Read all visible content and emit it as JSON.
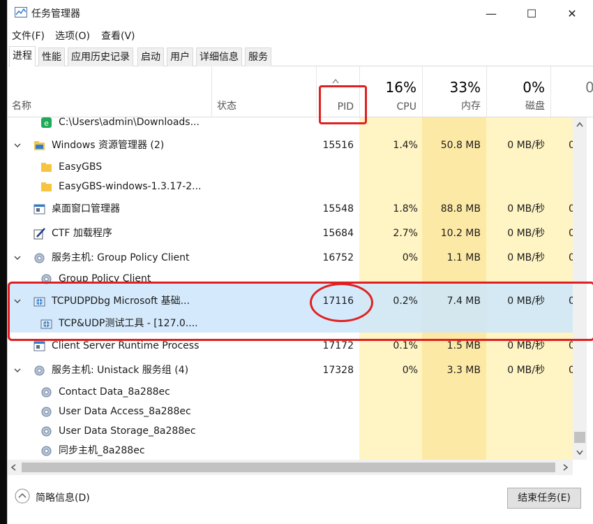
{
  "window": {
    "title": "任务管理器",
    "minimize": "—",
    "maximize": "☐",
    "close": "✕"
  },
  "menu": [
    "文件(F)",
    "选项(O)",
    "查看(V)"
  ],
  "tabs": [
    "进程",
    "性能",
    "应用历史记录",
    "启动",
    "用户",
    "详细信息",
    "服务"
  ],
  "header": {
    "name": "名称",
    "status": "状态",
    "pid": "PID",
    "cpu_pct": "16%",
    "cpu": "CPU",
    "mem_pct": "33%",
    "mem": "内存",
    "disk_pct": "0%",
    "disk": "磁盘",
    "net_pct": "0"
  },
  "rows": [
    {
      "name": "C:\\Users\\admin\\Downloads...",
      "pid": "",
      "cpu": "",
      "mem": "",
      "disk": "",
      "net": "",
      "indent": 1,
      "icon": "green-app-icon",
      "expand": false
    },
    {
      "name": "Windows 资源管理器 (2)",
      "pid": "15516",
      "cpu": "1.4%",
      "mem": "50.8 MB",
      "disk": "0 MB/秒",
      "net": "0",
      "indent": 0,
      "icon": "folder-explorer-icon",
      "expand": true
    },
    {
      "name": "EasyGBS",
      "pid": "",
      "cpu": "",
      "mem": "",
      "disk": "",
      "net": "",
      "indent": 1,
      "icon": "folder-icon",
      "expand": false
    },
    {
      "name": "EasyGBS-windows-1.3.17-2...",
      "pid": "",
      "cpu": "",
      "mem": "",
      "disk": "",
      "net": "",
      "indent": 1,
      "icon": "folder-icon",
      "expand": false
    },
    {
      "name": "桌面窗口管理器",
      "pid": "15548",
      "cpu": "1.8%",
      "mem": "88.8 MB",
      "disk": "0 MB/秒",
      "net": "0",
      "indent": 0,
      "icon": "window-icon",
      "expand": false
    },
    {
      "name": "CTF 加载程序",
      "pid": "15684",
      "cpu": "2.7%",
      "mem": "10.2 MB",
      "disk": "0 MB/秒",
      "net": "0",
      "indent": 0,
      "icon": "pen-icon",
      "expand": false
    },
    {
      "name": "服务主机: Group Policy Client",
      "pid": "16752",
      "cpu": "0%",
      "mem": "1.1 MB",
      "disk": "0 MB/秒",
      "net": "0",
      "indent": 0,
      "icon": "gear-icon",
      "expand": true
    },
    {
      "name": "Group Policy Client",
      "pid": "",
      "cpu": "",
      "mem": "",
      "disk": "",
      "net": "",
      "indent": 1,
      "icon": "gear-icon",
      "expand": false
    },
    {
      "name": "TCPUDPDbg Microsoft 基础...",
      "pid": "17116",
      "cpu": "0.2%",
      "mem": "7.4 MB",
      "disk": "0 MB/秒",
      "net": "0",
      "indent": 0,
      "icon": "network-app-icon",
      "expand": true
    },
    {
      "name": "TCP&UDP测试工具 - [127.0....",
      "pid": "",
      "cpu": "",
      "mem": "",
      "disk": "",
      "net": "",
      "indent": 1,
      "icon": "network-app-icon",
      "expand": false
    },
    {
      "name": "Client Server Runtime Process",
      "pid": "17172",
      "cpu": "0.1%",
      "mem": "1.5 MB",
      "disk": "0 MB/秒",
      "net": "0",
      "indent": 0,
      "icon": "window-icon",
      "expand": false
    },
    {
      "name": "服务主机: Unistack 服务组 (4)",
      "pid": "17328",
      "cpu": "0%",
      "mem": "3.3 MB",
      "disk": "0 MB/秒",
      "net": "0",
      "indent": 0,
      "icon": "gear-icon",
      "expand": true
    },
    {
      "name": "Contact Data_8a288ec",
      "pid": "",
      "cpu": "",
      "mem": "",
      "disk": "",
      "net": "",
      "indent": 1,
      "icon": "gear-icon",
      "expand": false
    },
    {
      "name": "User Data Access_8a288ec",
      "pid": "",
      "cpu": "",
      "mem": "",
      "disk": "",
      "net": "",
      "indent": 1,
      "icon": "gear-icon",
      "expand": false
    },
    {
      "name": "User Data Storage_8a288ec",
      "pid": "",
      "cpu": "",
      "mem": "",
      "disk": "",
      "net": "",
      "indent": 1,
      "icon": "gear-icon",
      "expand": false
    },
    {
      "name": "同步主机_8a288ec",
      "pid": "",
      "cpu": "",
      "mem": "",
      "disk": "",
      "net": "",
      "indent": 1,
      "icon": "gear-icon",
      "expand": false
    }
  ],
  "footer": {
    "summary": "简略信息(D)",
    "end_task": "结束任务(E)"
  },
  "colors": {
    "cpu_bg": "#fff4c4",
    "mem_bg": "#fde9a6",
    "highlight": "#cce6fb",
    "annotation": "#e02020"
  }
}
